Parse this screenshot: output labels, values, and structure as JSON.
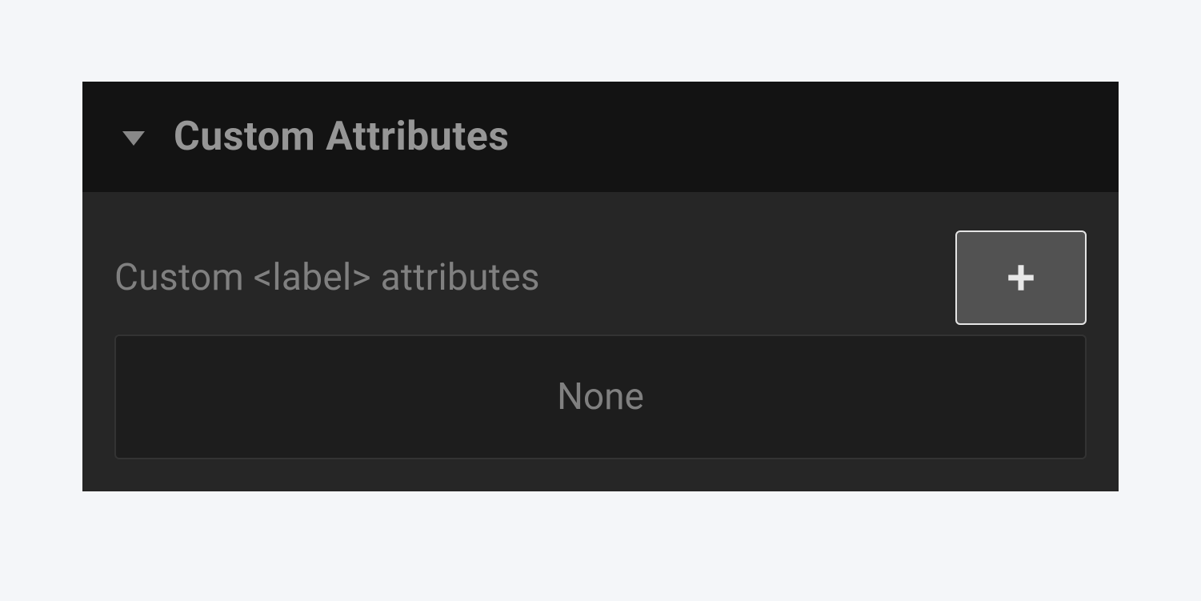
{
  "panel": {
    "title": "Custom Attributes",
    "row_label": "Custom <label> attributes",
    "empty_text": "None"
  }
}
